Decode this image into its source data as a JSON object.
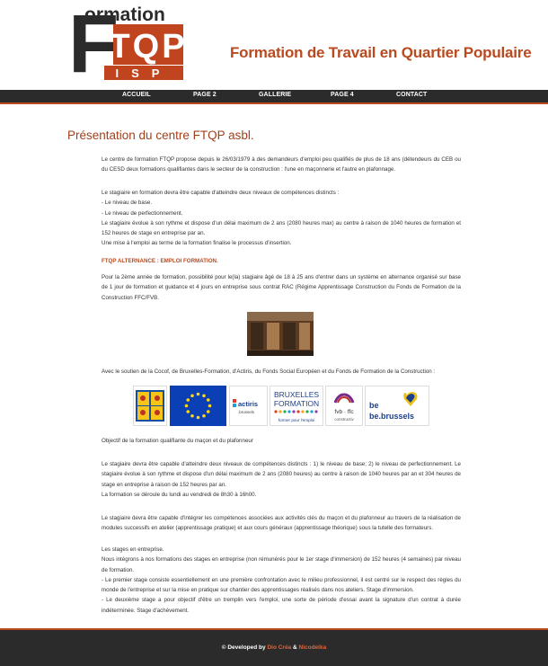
{
  "header": {
    "logo": {
      "word": "ormation",
      "big_letter": "F",
      "mid": "TQP",
      "sub": "ISP"
    },
    "site_title": "Formation de Travail en Quartier Populaire"
  },
  "nav": {
    "items": [
      {
        "label": "ACCUEIL"
      },
      {
        "label": "PAGE 2"
      },
      {
        "label": "GALLERIE"
      },
      {
        "label": "PAGE 4"
      },
      {
        "label": "CONTACT"
      }
    ]
  },
  "main": {
    "heading": "Présentation du centre FTQP asbl.",
    "p1": "Le centre de formation FTQP propose depuis le 26/03/1979 à des demandeurs d'emploi peu qualifiés de plus de 18 ans (détendeurs du CEB ou du CESD deux formations qualifiantes dans le secteur de la construction : l'une en maçonnerie et l'autre en plafonnage.",
    "p2_lines": [
      "Le stagiaire en formation devra être capable d'atteindre deux niveaux de compétences distincts :",
      "- Le niveau de base.",
      "- Le niveau de perfectionnement.",
      "Le stagiaire évolue à son rythme et dispose d'un délai maximum de 2 ans (2080 heures max) au centre à raison de 1040 heures de formation et 152 heures de stage en entreprise par an.",
      "Une mise à l'emploi au terme de la formation finalise le processus d'insertion."
    ],
    "alternance_title": "FTQP ALTERNANCE : EMPLOI FORMATION.",
    "p3": "Pour la 2ème année de formation, possibilité pour le(la) stagiaire âgé de 18 à 25 ans d'entrer dans un système en alternance organisé sur base de 1 jour de formation et guidance et 4 jours en entreprise sous contrat RAC (Régime Apprentissage Construction du Fonds de Formation de la Construction FFC/FVB.",
    "p4": "Avec le soutien de la Cocof, de Bruxelles-Formation, d'Actiris, du Fonds Social Européen et du Fonds de Formation de la Construction :",
    "sponsors": [
      {
        "name": "cocof"
      },
      {
        "name": "eu"
      },
      {
        "name": "actiris",
        "text": "actiris",
        "sub": ".brussels"
      },
      {
        "name": "bruxelles-formation",
        "text1": "BRUXELLES",
        "text2": "FORMATION",
        "text3": "former pour l'emploi"
      },
      {
        "name": "fvb-ffc",
        "text1": "fvb · ffc",
        "text2": "constructiv"
      },
      {
        "name": "be-brussels",
        "text1": "be",
        "text2": "be.brussels"
      }
    ],
    "p5": "Objectif de la formation qualifiante du maçon et du plafonneur",
    "p6_lines": [
      "Le stagiaire devra être capable d'atteindre deux niveaux de compétences distincts : 1) le niveau de base; 2) le niveau de perfectionnement. Le stagiaire évolue à son rythme et dispose d'un délai maximum de 2 ans (2080 heures) au centre à raison de 1040 heures par an et 304 heures de stage en entreprise à raison de 152 heures par an.",
      "La formation se déroule du lundi au vendredi de 8h30 à 16h00."
    ],
    "p7": "Le stagiaire devra être capable d'intégrer les compétences associées aux activités clés du maçon et du plafonneur au travers de la réalisation de modules successifs en atelier (apprentissage pratique) et aux cours généraux (apprentissage théorique) sous la tutelle des formateurs.",
    "p8_lines": [
      "Les stages en entreprise.",
      "Nous intégrons à nos formations des stages en entreprise (non rémunérés pour le 1er stage d'immersion) de 152 heures (4 semaines) par niveau de formation.",
      "- Le premier stage consiste essentiellement en une première confrontation avec le milieu professionnel, il est centré sur le respect des règles du monde de l'entreprise et sur la mise en pratique sur chantier des apprentissages réalisés dans nos ateliers. Stage d'immersion.",
      "- Le deuxième stage a pour objectif d'être un tremplin vers l'emploi, une sorte de période d'essai avant la signature d'un contrat à durée indéterminée. Stage d'achèvement."
    ]
  },
  "footer": {
    "prefix": "© Developed by",
    "dev1": "Dio Créa",
    "amp": "&",
    "dev2": "Nicodelka"
  },
  "colors": {
    "accent": "#b94a1f",
    "dark": "#2b2b2b"
  }
}
